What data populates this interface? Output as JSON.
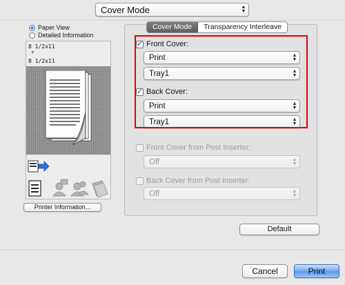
{
  "top_select": {
    "value": "Cover Mode"
  },
  "view_options": [
    {
      "label": "Paper View",
      "selected": true
    },
    {
      "label": "Detailed Information",
      "selected": false
    }
  ],
  "paper": {
    "size_top": "8 1/2x11",
    "size_bottom": "8 1/2x11"
  },
  "printer_info_button": "Printer Information...",
  "tabs": [
    {
      "label": "Cover Mode",
      "selected": true
    },
    {
      "label": "Transparency Interleave",
      "selected": false
    }
  ],
  "front_cover": {
    "label": "Front Cover:",
    "checked": true,
    "mode": "Print",
    "tray": "Tray1"
  },
  "back_cover": {
    "label": "Back Cover:",
    "checked": true,
    "mode": "Print",
    "tray": "Tray1"
  },
  "front_post": {
    "label": "Front Cover from Post Inserter:",
    "checked": false,
    "enabled": false,
    "value": "Off"
  },
  "back_post": {
    "label": "Back Cover from Post Inserter:",
    "checked": false,
    "enabled": false,
    "value": "Off"
  },
  "default_button": "Default",
  "cancel_button": "Cancel",
  "print_button": "Print",
  "colors": {
    "highlight": "#e00000",
    "accent": "#5b96e8"
  }
}
